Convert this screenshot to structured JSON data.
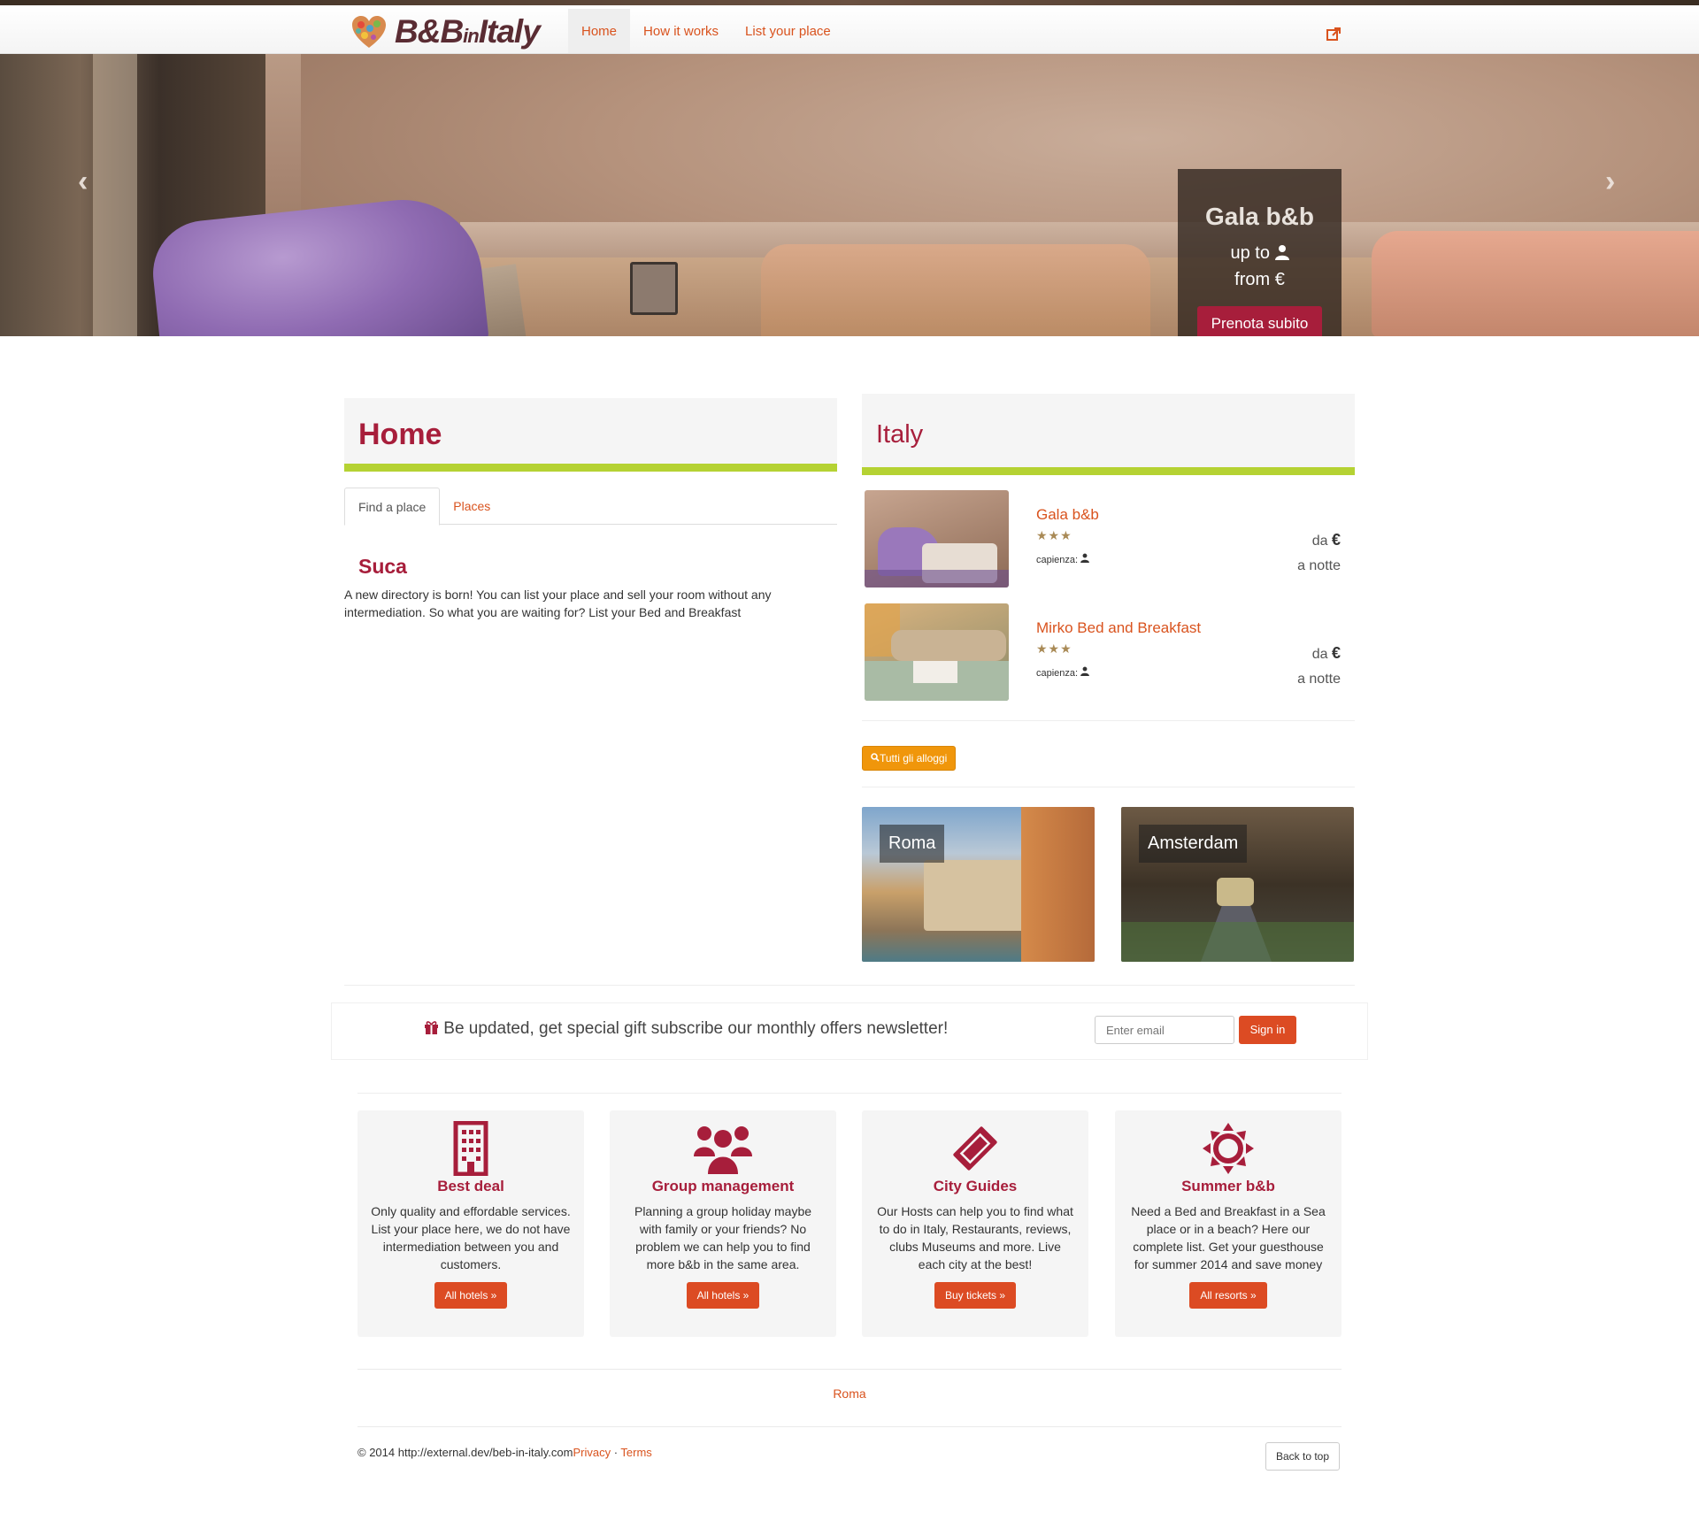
{
  "navbar": {
    "logo_text": "B&B",
    "logo_in": "in",
    "logo_tail": "Italy",
    "items": [
      {
        "label": "Home",
        "active": true
      },
      {
        "label": "How it works",
        "active": false
      },
      {
        "label": "List your place",
        "active": false
      }
    ],
    "share_icon": "share-icon"
  },
  "hero": {
    "prev_glyph": "‹",
    "next_glyph": "›",
    "caption_title": "Gala b&b",
    "caption_up_to": "up to",
    "caption_from": "from €",
    "caption_button": "Prenota subito"
  },
  "home": {
    "title": "Home",
    "tabs": [
      {
        "label": "Find a place",
        "active": true
      },
      {
        "label": "Places",
        "active": false
      }
    ],
    "heading": "Suca",
    "description": "A new directory is born! You can list your place and sell your room without any intermediation. So what you are waiting for? List your Bed and Breakfast"
  },
  "italy": {
    "title": "Italy",
    "listings": [
      {
        "name": "Gala b&b",
        "stars": "★★★",
        "capacity": "capienza:",
        "price_prefix": "da",
        "currency": "€",
        "per": "a notte"
      },
      {
        "name": "Mirko Bed and Breakfast",
        "stars": "★★★",
        "capacity": "capienza:",
        "price_prefix": "da",
        "currency": "€",
        "per": "a notte"
      }
    ],
    "all_button": "Tutti gli alloggi",
    "cities": [
      "Roma",
      "Amsterdam"
    ]
  },
  "newsletter": {
    "text": "Be updated, get special gift subscribe our monthly offers newsletter!",
    "placeholder": "Enter email",
    "button": "Sign in"
  },
  "features": [
    {
      "icon": "building-icon",
      "title": "Best deal",
      "text": "Only quality and effordable services. List your place here, we do not have intermediation between you and customers.",
      "button": "All hotels »"
    },
    {
      "icon": "group-icon",
      "title": "Group management",
      "text": "Planning a group holiday maybe with family or your friends? No problem we can help you to find more b&b in the same area.",
      "button": "All hotels »"
    },
    {
      "icon": "ticket-icon",
      "title": "City Guides",
      "text": "Our Hosts can help you to find what to do in Italy, Restaurants, reviews, clubs Museums and more. Live each city at the best!",
      "button": "Buy tickets »"
    },
    {
      "icon": "sun-icon",
      "title": "Summer b&b",
      "text": "Need a Bed and Breakfast in a Sea place or in a beach? Here our complete list. Get your guesthouse for summer 2014 and save money",
      "button": "All resorts »"
    }
  ],
  "footer": {
    "roma_link": "Roma",
    "copyright": "© 2014 http://external.dev/beb-in-italy.com",
    "privacy": "Privacy",
    "dot": " · ",
    "terms": "Terms",
    "back_to_top": "Back to top"
  },
  "colors": {
    "brand": "#a71e3b",
    "link": "#d9531e",
    "accent_bar": "#b5d233",
    "button_orange": "#dc4b23"
  }
}
